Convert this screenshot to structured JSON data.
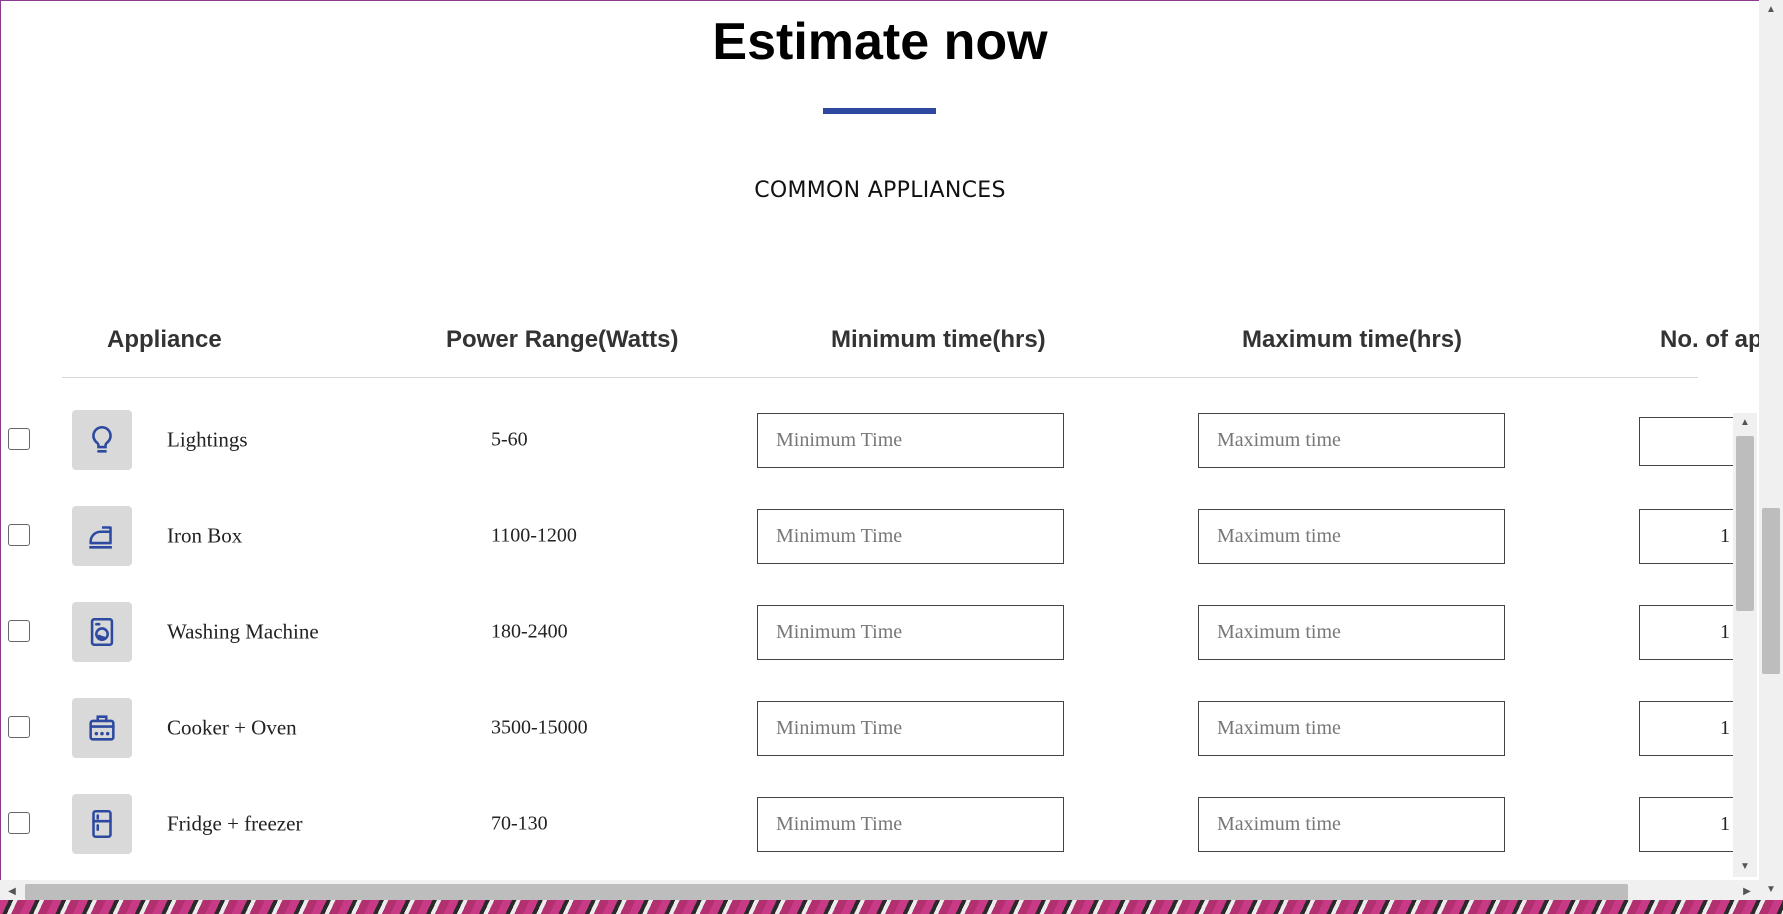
{
  "page": {
    "title": "Estimate now",
    "subtitle": "COMMON APPLIANCES",
    "accent_color": "#2d4aa0"
  },
  "table": {
    "headers": [
      "Appliance",
      "Power Range(Watts)",
      "Minimum time(hrs)",
      "Maximum time(hrs)",
      "No. of ap"
    ],
    "rows": [
      {
        "name": "Lightings",
        "power": "5-60",
        "icon": "lightbulb-icon",
        "min_placeholder": "Minimum Time",
        "max_placeholder": "Maximum time",
        "count": ""
      },
      {
        "name": "Iron Box",
        "power": "1100-1200",
        "icon": "iron-icon",
        "min_placeholder": "Minimum Time",
        "max_placeholder": "Maximum time",
        "count": "1"
      },
      {
        "name": "Washing Machine",
        "power": "180-2400",
        "icon": "washing-machine-icon",
        "min_placeholder": "Minimum Time",
        "max_placeholder": "Maximum time",
        "count": "1"
      },
      {
        "name": "Cooker + Oven",
        "power": "3500-15000",
        "icon": "oven-icon",
        "min_placeholder": "Minimum Time",
        "max_placeholder": "Maximum time",
        "count": "1"
      },
      {
        "name": "Fridge + freezer",
        "power": "70-130",
        "icon": "fridge-icon",
        "min_placeholder": "Minimum Time",
        "max_placeholder": "Maximum time",
        "count": "1"
      }
    ]
  }
}
